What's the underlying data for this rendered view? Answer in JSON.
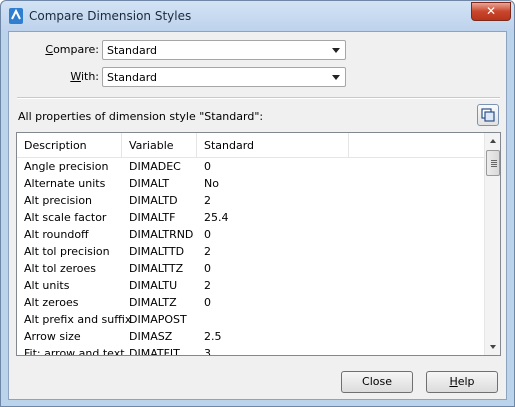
{
  "window": {
    "title": "Compare Dimension Styles",
    "close_glyph": "✕"
  },
  "compare": {
    "label_prefix": "C",
    "label_rest": "ompare:",
    "value": "Standard"
  },
  "with": {
    "label_prefix": "W",
    "label_rest": "ith:",
    "value": "Standard"
  },
  "properties_label": "All properties of dimension style \"Standard\":",
  "table": {
    "columns": [
      "Description",
      "Variable",
      "Standard"
    ],
    "rows": [
      {
        "description": "Angle precision",
        "variable": "DIMADEC",
        "value": "0"
      },
      {
        "description": "Alternate units",
        "variable": "DIMALT",
        "value": "No"
      },
      {
        "description": "Alt precision",
        "variable": "DIMALTD",
        "value": "2"
      },
      {
        "description": "Alt scale factor",
        "variable": "DIMALTF",
        "value": "25.4"
      },
      {
        "description": "Alt roundoff",
        "variable": "DIMALTRND",
        "value": "0"
      },
      {
        "description": "Alt tol precision",
        "variable": "DIMALTTD",
        "value": "2"
      },
      {
        "description": "Alt tol zeroes",
        "variable": "DIMALTTZ",
        "value": "0"
      },
      {
        "description": "Alt units",
        "variable": "DIMALTU",
        "value": "2"
      },
      {
        "description": "Alt zeroes",
        "variable": "DIMALTZ",
        "value": "0"
      },
      {
        "description": "Alt prefix and suffix",
        "variable": "DIMAPOST",
        "value": ""
      },
      {
        "description": "Arrow size",
        "variable": "DIMASZ",
        "value": "2.5"
      },
      {
        "description": "Fit: arrow and text",
        "variable": "DIMATFIT",
        "value": "3"
      }
    ]
  },
  "buttons": {
    "close_label": "Close",
    "help_prefix": "H",
    "help_rest": "elp"
  },
  "icons": {
    "app": "autocad-dim-icon",
    "copy": "copy-to-clipboard-icon"
  },
  "colors": {
    "title_bar": "#bcd3ec",
    "close_button": "#c9462c"
  }
}
